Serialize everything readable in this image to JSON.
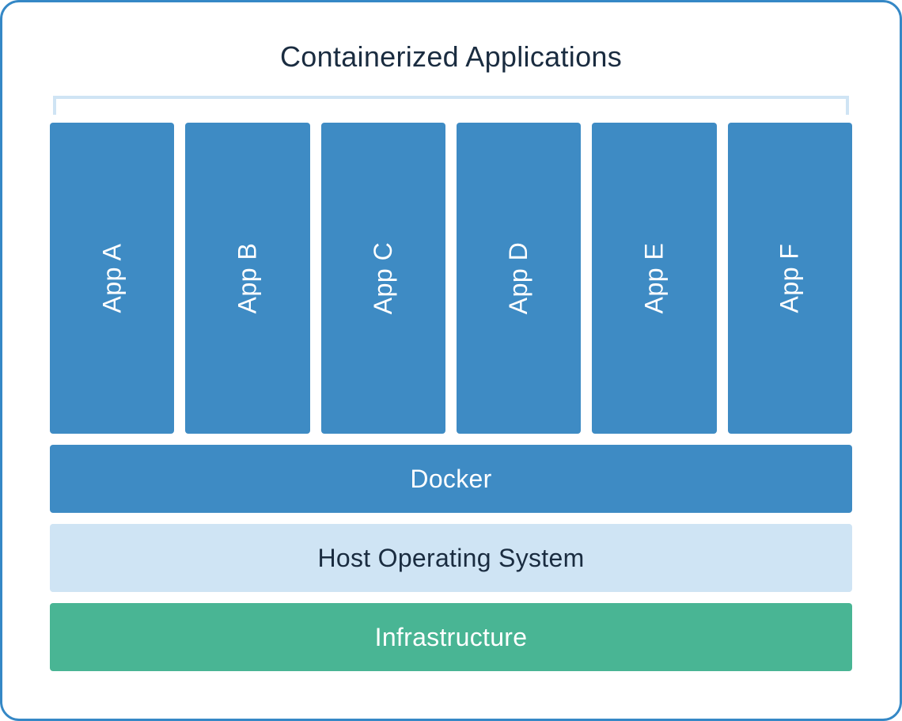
{
  "title": "Containerized Applications",
  "apps": [
    {
      "label": "App A"
    },
    {
      "label": "App B"
    },
    {
      "label": "App C"
    },
    {
      "label": "App D"
    },
    {
      "label": "App E"
    },
    {
      "label": "App F"
    }
  ],
  "layers": {
    "docker": "Docker",
    "os": "Host Operating System",
    "infrastructure": "Infrastructure"
  },
  "colors": {
    "border": "#3588c6",
    "app_box": "#3e8bc4",
    "docker": "#3e8bc4",
    "os_bg": "#cfe4f4",
    "os_text": "#1a2c40",
    "infrastructure": "#49b594",
    "bracket": "#cfe4f4",
    "title_text": "#1a2c40"
  }
}
